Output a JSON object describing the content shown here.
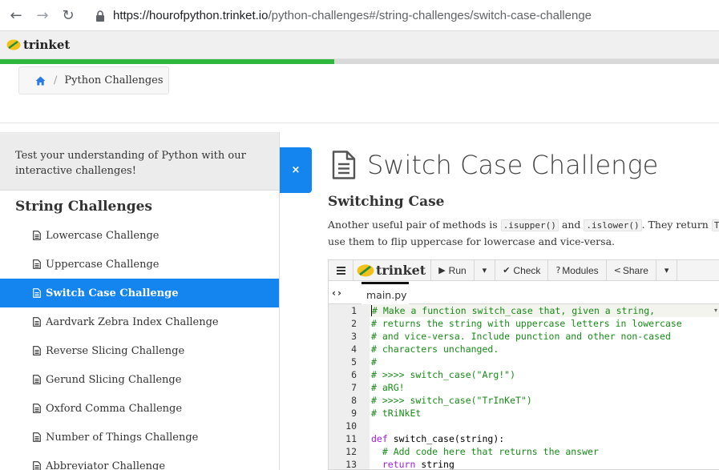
{
  "browser": {
    "url_host": "https://hourofpython.trinket.io",
    "url_path": "/python-challenges#/string-challenges/switch-case-challenge"
  },
  "brand": "trinket",
  "progress": 0.465,
  "breadcrumb": {
    "current": "Python Challenges"
  },
  "sidebar": {
    "intro": [
      "Test your understanding of Python with our",
      "interactive challenges!"
    ],
    "section_title": "String Challenges",
    "items": [
      {
        "label": "Lowercase Challenge"
      },
      {
        "label": "Uppercase Challenge"
      },
      {
        "label": "Switch Case Challenge",
        "active": true
      },
      {
        "label": "Aardvark Zebra Index Challenge"
      },
      {
        "label": "Reverse Slicing Challenge"
      },
      {
        "label": "Gerund Slicing Challenge"
      },
      {
        "label": "Oxford Comma Challenge"
      },
      {
        "label": "Number of Things Challenge"
      },
      {
        "label": "Abbreviator Challenge"
      }
    ]
  },
  "close_label": "×",
  "main": {
    "title": "Switch Case Challenge",
    "subheading": "Switching Case",
    "desc_1a": "Another useful pair of methods is ",
    "code_isupper": ".isupper()",
    "desc_1b": " and ",
    "code_islower": ".islower()",
    "desc_1c": ". They return ",
    "code_true": "True",
    "desc_2": "use them to flip uppercase for lowercase and vice-versa."
  },
  "embed": {
    "menu_icon": "hamburger-icon",
    "brand": "trinket",
    "run_label": "Run",
    "check_label": "Check",
    "modules_label": "Modules",
    "share_label": "Share",
    "filename": "main.py",
    "code_lines": [
      {
        "n": "1",
        "kind": "comment",
        "text": "# Make a function switch_case that, given a string,"
      },
      {
        "n": "2",
        "kind": "comment",
        "text": "# returns the string with uppercase letters in lowercase"
      },
      {
        "n": "3",
        "kind": "comment",
        "text": "# and vice-versa. Include punction and other non-cased"
      },
      {
        "n": "4",
        "kind": "comment",
        "text": "# characters unchanged."
      },
      {
        "n": "5",
        "kind": "comment",
        "text": "#"
      },
      {
        "n": "6",
        "kind": "comment",
        "text": "# >>>> switch_case(\"Arg!\")"
      },
      {
        "n": "7",
        "kind": "comment",
        "text": "# aRG!"
      },
      {
        "n": "8",
        "kind": "comment",
        "text": "# >>>> switch_case(\"TrInKeT\")"
      },
      {
        "n": "9",
        "kind": "comment",
        "text": "# tRiNkEt"
      },
      {
        "n": "10",
        "kind": "blank",
        "text": ""
      },
      {
        "n": "11",
        "kind": "def",
        "keyword": "def",
        "text": " switch_case(string):"
      },
      {
        "n": "12",
        "kind": "comment",
        "indent": "  ",
        "text": "# Add code here that returns the answer"
      },
      {
        "n": "13",
        "kind": "return",
        "indent": "  ",
        "keyword": "return",
        "text": " string"
      }
    ]
  }
}
